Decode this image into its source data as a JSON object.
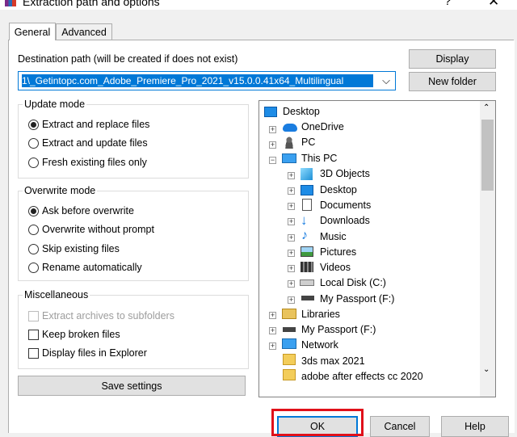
{
  "window": {
    "title": "Extraction path and options",
    "help": "?",
    "close": "✕"
  },
  "tabs": [
    "General",
    "Advanced"
  ],
  "destination": {
    "label": "Destination path (will be created if does not exist)",
    "value": "1\\_Getintopc.com_Adobe_Premiere_Pro_2021_v15.0.0.41x64_Multilingual"
  },
  "buttons": {
    "display": "Display",
    "new_folder": "New folder",
    "save_settings": "Save settings",
    "ok": "OK",
    "cancel": "Cancel",
    "help": "Help"
  },
  "update_mode": {
    "title": "Update mode",
    "options": [
      "Extract and replace files",
      "Extract and update files",
      "Fresh existing files only"
    ],
    "selected": 0
  },
  "overwrite_mode": {
    "title": "Overwrite mode",
    "options": [
      "Ask before overwrite",
      "Overwrite without prompt",
      "Skip existing files",
      "Rename automatically"
    ],
    "selected": 0
  },
  "miscellaneous": {
    "title": "Miscellaneous",
    "options": [
      "Extract archives to subfolders",
      "Keep broken files",
      "Display files in Explorer"
    ]
  },
  "tree": [
    {
      "label": "Desktop",
      "icon": "desktop-folder-icon"
    },
    {
      "label": "OneDrive",
      "icon": "cloud-icon"
    },
    {
      "label": "PC",
      "icon": "user-icon"
    },
    {
      "label": "This PC",
      "icon": "computer-icon"
    },
    {
      "label": "3D Objects",
      "icon": "cube-icon"
    },
    {
      "label": "Desktop",
      "icon": "desktop-folder-icon"
    },
    {
      "label": "Documents",
      "icon": "document-icon"
    },
    {
      "label": "Downloads",
      "icon": "download-arrow-icon"
    },
    {
      "label": "Music",
      "icon": "music-note-icon"
    },
    {
      "label": "Pictures",
      "icon": "picture-icon"
    },
    {
      "label": "Videos",
      "icon": "film-icon"
    },
    {
      "label": "Local Disk (C:)",
      "icon": "drive-icon"
    },
    {
      "label": "My Passport (F:)",
      "icon": "usb-drive-icon"
    },
    {
      "label": "Libraries",
      "icon": "library-icon"
    },
    {
      "label": "My Passport (F:)",
      "icon": "usb-drive-icon"
    },
    {
      "label": "Network",
      "icon": "network-icon"
    },
    {
      "label": "3ds max 2021",
      "icon": "folder-icon"
    },
    {
      "label": "adobe after effects cc 2020",
      "icon": "folder-icon"
    }
  ],
  "colors": {
    "accent": "#0078d7",
    "highlight": "#e0101a"
  }
}
